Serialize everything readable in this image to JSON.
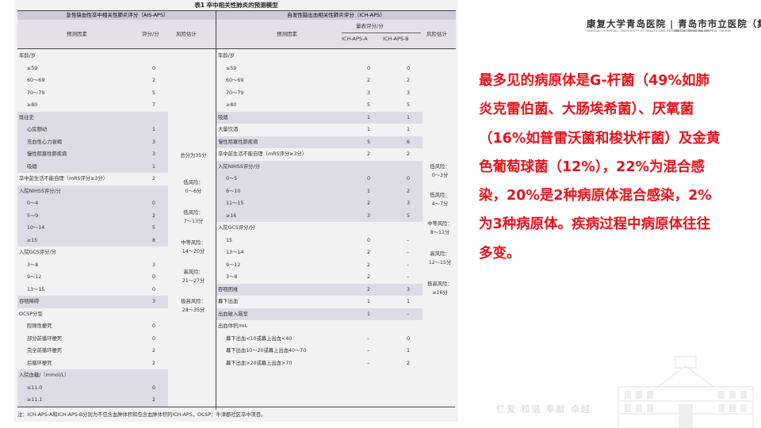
{
  "table": {
    "caption": "表1  卒中相关性肺炎的预测模型",
    "left_title": "急性缺血性卒中相关性肺炎评分（AIS-APS）",
    "right_title": "自发性脑出血相关性肺炎评分（ICH-APS）",
    "left_headers": {
      "factor": "预测因素",
      "score": "评分/分",
      "risk": "风险估计"
    },
    "right_headers": {
      "factor": "预测因素",
      "score_group": "量表评分/分",
      "score_a": "ICH-APS-A",
      "score_b": "ICH-APS-B",
      "risk": "风险估计"
    },
    "left_rows": [
      {
        "factor": "年龄/岁",
        "score": "",
        "indent": false,
        "shaded": false
      },
      {
        "factor": "≤59",
        "score": "0",
        "indent": true,
        "shaded": false
      },
      {
        "factor": "60～69",
        "score": "2",
        "indent": true,
        "shaded": false
      },
      {
        "factor": "70～79",
        "score": "5",
        "indent": true,
        "shaded": false
      },
      {
        "factor": "≥80",
        "score": "7",
        "indent": true,
        "shaded": false
      },
      {
        "factor": "既往史",
        "score": "",
        "indent": false,
        "shaded": true
      },
      {
        "factor": "心房颤动",
        "score": "1",
        "indent": true,
        "shaded": true
      },
      {
        "factor": "充血性心力衰竭",
        "score": "3",
        "indent": true,
        "shaded": true
      },
      {
        "factor": "慢性阻塞性肺疾病",
        "score": "3",
        "indent": true,
        "shaded": true
      },
      {
        "factor": "吸烟",
        "score": "1",
        "indent": true,
        "shaded": true
      },
      {
        "factor": "卒中前生活不能自理（mRS评分≥3分）",
        "score": "2",
        "indent": false,
        "shaded": false
      },
      {
        "factor": "入院NIHSS评分/分",
        "score": "",
        "indent": false,
        "shaded": true
      },
      {
        "factor": "0～4",
        "score": "0",
        "indent": true,
        "shaded": true
      },
      {
        "factor": "5～9",
        "score": "2",
        "indent": true,
        "shaded": true
      },
      {
        "factor": "10～14",
        "score": "5",
        "indent": true,
        "shaded": true
      },
      {
        "factor": "≥15",
        "score": "8",
        "indent": true,
        "shaded": true
      },
      {
        "factor": "入院GCS评分/分",
        "score": "",
        "indent": false,
        "shaded": false
      },
      {
        "factor": "3～8",
        "score": "3",
        "indent": true,
        "shaded": false
      },
      {
        "factor": "9～12",
        "score": "0",
        "indent": true,
        "shaded": false
      },
      {
        "factor": "13～15",
        "score": "0",
        "indent": true,
        "shaded": false
      },
      {
        "factor": "吞咽障碍",
        "score": "3",
        "indent": false,
        "shaded": true
      },
      {
        "factor": "OCSP分型",
        "score": "",
        "indent": false,
        "shaded": false
      },
      {
        "factor": "腔隙性梗死",
        "score": "0",
        "indent": true,
        "shaded": false
      },
      {
        "factor": "部分前循环梗死",
        "score": "0",
        "indent": true,
        "shaded": false
      },
      {
        "factor": "完全前循环梗死",
        "score": "2",
        "indent": true,
        "shaded": false
      },
      {
        "factor": "后循环梗死",
        "score": "2",
        "indent": true,
        "shaded": false
      },
      {
        "factor": "入院血糖/（mmol/L）",
        "score": "",
        "indent": false,
        "shaded": true
      },
      {
        "factor": "≤11.0",
        "score": "0",
        "indent": true,
        "shaded": true
      },
      {
        "factor": "≥11.1",
        "score": "2",
        "indent": true,
        "shaded": true
      }
    ],
    "left_risk": [
      "总分为35分",
      "低风险：\n0～6分",
      "低风险：\n7～13分",
      "中等风险：\n14～20分",
      "高风险：\n21～27分",
      "极高风险：\n28～35分"
    ],
    "right_rows": [
      {
        "factor": "年龄/岁",
        "a": "",
        "b": "",
        "indent": false,
        "shaded": false
      },
      {
        "factor": "≤59",
        "a": "0",
        "b": "0",
        "indent": true,
        "shaded": false
      },
      {
        "factor": "60～69",
        "a": "2",
        "b": "2",
        "indent": true,
        "shaded": false
      },
      {
        "factor": "70～79",
        "a": "3",
        "b": "3",
        "indent": true,
        "shaded": false
      },
      {
        "factor": "≥80",
        "a": "5",
        "b": "5",
        "indent": true,
        "shaded": false
      },
      {
        "factor": "吸烟",
        "a": "1",
        "b": "1",
        "indent": false,
        "shaded": true
      },
      {
        "factor": "大量饮酒",
        "a": "1",
        "b": "1",
        "indent": false,
        "shaded": false
      },
      {
        "factor": "慢性阻塞性肺疾病",
        "a": "5",
        "b": "6",
        "indent": false,
        "shaded": true
      },
      {
        "factor": "卒中前生活不能自理（mRS评分≥3分）",
        "a": "2",
        "b": "2",
        "indent": false,
        "shaded": false
      },
      {
        "factor": "入院NIHSS评分/分",
        "a": "",
        "b": "",
        "indent": false,
        "shaded": true
      },
      {
        "factor": "0～5",
        "a": "0",
        "b": "0",
        "indent": true,
        "shaded": true
      },
      {
        "factor": "6～10",
        "a": "1",
        "b": "2",
        "indent": true,
        "shaded": true
      },
      {
        "factor": "11～15",
        "a": "2",
        "b": "3",
        "indent": true,
        "shaded": true
      },
      {
        "factor": "≥16",
        "a": "3",
        "b": "5",
        "indent": true,
        "shaded": true
      },
      {
        "factor": "入院GCS评分/分",
        "a": "",
        "b": "",
        "indent": false,
        "shaded": false
      },
      {
        "factor": "15",
        "a": "0",
        "b": "–",
        "indent": true,
        "shaded": false
      },
      {
        "factor": "13～14",
        "a": "2",
        "b": "–",
        "indent": true,
        "shaded": false
      },
      {
        "factor": "9～12",
        "a": "2",
        "b": "–",
        "indent": true,
        "shaded": false
      },
      {
        "factor": "3～8",
        "a": "2",
        "b": "–",
        "indent": true,
        "shaded": false
      },
      {
        "factor": "吞咽困难",
        "a": "2",
        "b": "3",
        "indent": false,
        "shaded": true
      },
      {
        "factor": "幕下出血",
        "a": "1",
        "b": "1",
        "indent": false,
        "shaded": false
      },
      {
        "factor": "出血破入脑室",
        "a": "1",
        "b": "–",
        "indent": false,
        "shaded": true
      },
      {
        "factor": "出血体积/mL",
        "a": "",
        "b": "",
        "indent": false,
        "shaded": false
      },
      {
        "factor": "幕下出血<10或幕上出血<40",
        "a": "–",
        "b": "0",
        "indent": true,
        "shaded": false
      },
      {
        "factor": "幕下出血10～20或幕上出血40～70",
        "a": "–",
        "b": "1",
        "indent": true,
        "shaded": false
      },
      {
        "factor": "幕下出血>20或幕上出血>70",
        "a": "–",
        "b": "2",
        "indent": true,
        "shaded": false
      }
    ],
    "right_risk": [
      "低风险：\n0～3分",
      "低风险：\n4～7分",
      "中等风险：\n8～11分",
      "高风险：\n12～15分",
      "极高风险：\n≥16分"
    ],
    "footnote": "注：ICH-APS-A和ICH-APS-B分别为不包含血肿体积和包含血肿体积的ICH-APS，OCSP：牛津郡社区卒中项目。"
  },
  "logo": {
    "name": "康复大学青岛医院 | 青岛市市立医院（集团）",
    "sub_left": "QINGDAO HOSPITAL, UNIVERSITY OF HEALTH AND REHABILITATION SCIENCES",
    "sub_right": "QINGDAO MUNICIPAL HOSPITAL（GROUP）"
  },
  "paragraph": "最多见的病原体是G-杆菌（49%如肺炎克雷伯菌、大肠埃希菌）、厌氧菌（16%如普雷沃菌和梭状杆菌）及金黄色葡萄球菌（12%），22%为混合感染，20%是2种病原体混合感染，2%为3种病原体。疾病过程中病原体往往多变。",
  "watermark": "仁爱  和谐  奉献  卓越",
  "colors": {
    "text_red": "#e6141b",
    "header_band": "#cfcad9",
    "shade": "#dddbe6"
  }
}
